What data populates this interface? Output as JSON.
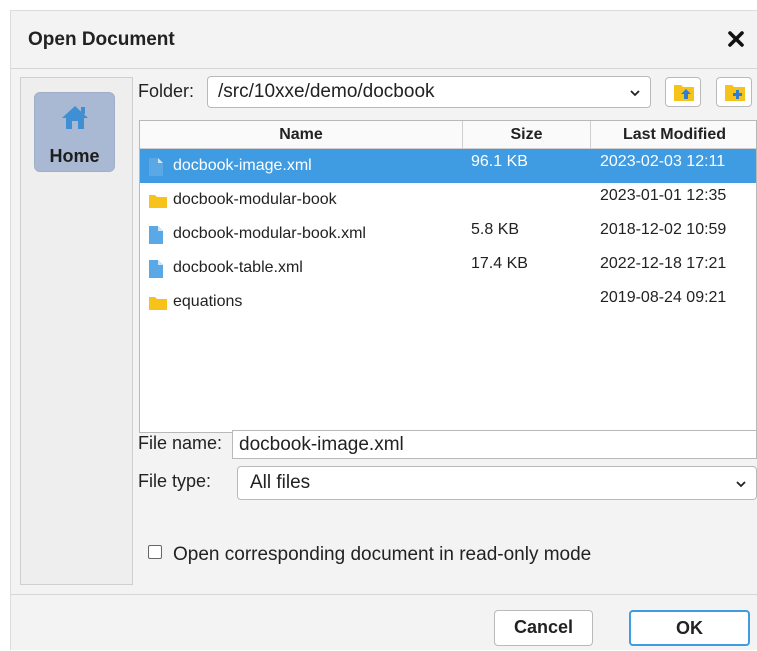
{
  "dialog": {
    "title": "Open Document"
  },
  "sidebar": {
    "home_label": "Home"
  },
  "folder": {
    "label": "Folder:",
    "path": "/src/10xxe/demo/docbook"
  },
  "table": {
    "columns": [
      "Name",
      "Size",
      "Last Modified"
    ],
    "rows": [
      {
        "name": "docbook-image.xml",
        "size": "96.1 KB",
        "modified": "2023-02-03 12:11",
        "icon": "file-icon",
        "selected": true
      },
      {
        "name": "docbook-modular-book",
        "size": "",
        "modified": "2023-01-01 12:35",
        "icon": "folder-icon",
        "selected": false
      },
      {
        "name": "docbook-modular-book.xml",
        "size": "5.8 KB",
        "modified": "2018-12-02 10:59",
        "icon": "file-icon",
        "selected": false
      },
      {
        "name": "docbook-table.xml",
        "size": "17.4 KB",
        "modified": "2022-12-18 17:21",
        "icon": "file-icon",
        "selected": false
      },
      {
        "name": "equations",
        "size": "",
        "modified": "2019-08-24 09:21",
        "icon": "folder-icon",
        "selected": false
      }
    ]
  },
  "file_name": {
    "label": "File name:",
    "value": "docbook-image.xml"
  },
  "file_type": {
    "label": "File type:",
    "value": "All files"
  },
  "options": {
    "readonly_label": "Open corresponding document in read-only mode",
    "readonly_checked": false
  },
  "buttons": {
    "cancel": "Cancel",
    "ok": "OK"
  },
  "colors": {
    "selection": "#3f9be2",
    "home_button": "#aab9d3",
    "folder": "#f7c21a",
    "file": "#5aa9e6",
    "ok_border": "#3f9be2"
  }
}
